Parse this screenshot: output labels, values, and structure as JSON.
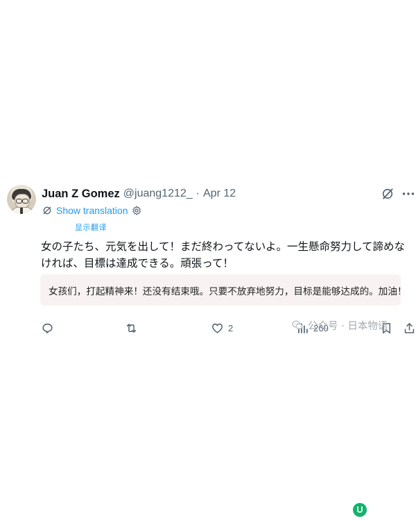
{
  "author": {
    "display_name": "Juan Z Gomez",
    "handle": "@juang1212_",
    "separator": "·",
    "date": "Apr 12"
  },
  "translation": {
    "link_label": "Show translation",
    "caption": "显示翻译"
  },
  "tweet": {
    "text": "女の子たち、元気を出して！まだ終わってないよ。一生懸命努力して諦めなければ、目標は達成できる。頑張って！",
    "translated_text": "女孩们，打起精神来！还没有结束哦。只要不放弃地努力，目标是能够达成的。加油！"
  },
  "actions": {
    "reply_count": "",
    "retweet_count": "",
    "like_count": "2",
    "views_count": "260"
  },
  "watermark": {
    "text": "公众号 · 日本物语"
  },
  "badge": {
    "letter": "U"
  },
  "colors": {
    "accent": "#1d9bf0",
    "muted": "#536471",
    "translation_bg": "#f8f3f2",
    "badge": "#13b36a"
  },
  "icons": [
    "grok-icon",
    "more-icon",
    "leaf-icon",
    "settings-icon",
    "reply-icon",
    "retweet-icon",
    "like-icon",
    "views-icon",
    "bookmark-icon",
    "share-icon"
  ]
}
